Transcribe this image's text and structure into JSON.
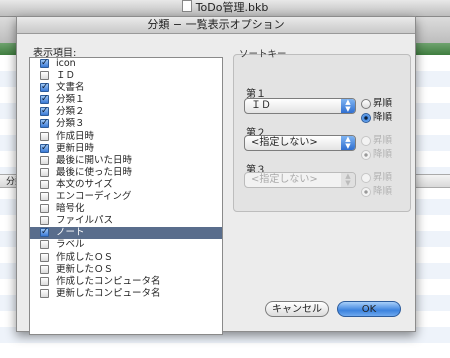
{
  "window": {
    "title": "ToDo管理.bkb"
  },
  "background": {
    "column_header": "分類名"
  },
  "dialog": {
    "title": "分類 − 一覧表示オプション",
    "list_label": "表示項目:",
    "items": [
      {
        "label": "icon",
        "checked": true
      },
      {
        "label": "ＩＤ",
        "checked": false
      },
      {
        "label": "文書名",
        "checked": true
      },
      {
        "label": "分類１",
        "checked": true
      },
      {
        "label": "分類２",
        "checked": true
      },
      {
        "label": "分類３",
        "checked": true
      },
      {
        "label": "作成日時",
        "checked": false
      },
      {
        "label": "更新日時",
        "checked": true
      },
      {
        "label": "最後に開いた日時",
        "checked": false
      },
      {
        "label": "最後に使った日時",
        "checked": false
      },
      {
        "label": "本文のサイズ",
        "checked": false
      },
      {
        "label": "エンコーディング",
        "checked": false
      },
      {
        "label": "暗号化",
        "checked": false
      },
      {
        "label": "ファイルパス",
        "checked": false
      },
      {
        "label": "ノート",
        "checked": true,
        "selected": true
      },
      {
        "label": "ラベル",
        "checked": false
      },
      {
        "label": "作成したＯＳ",
        "checked": false
      },
      {
        "label": "更新したＯＳ",
        "checked": false
      },
      {
        "label": "作成したコンピュータ名",
        "checked": false
      },
      {
        "label": "更新したコンピュータ名",
        "checked": false
      }
    ],
    "sort": {
      "group_label": "ソートキー",
      "keys": [
        {
          "label": "第１",
          "value": "ＩＤ",
          "enabled": true,
          "ascending": "昇順",
          "descending": "降順",
          "order": "descending"
        },
        {
          "label": "第２",
          "value": "<指定しない>",
          "enabled": true,
          "ascending": "昇順",
          "descending": "降順",
          "order": "descending"
        },
        {
          "label": "第３",
          "value": "<指定しない>",
          "enabled": false,
          "ascending": "昇順",
          "descending": "降順",
          "order": "descending"
        }
      ]
    },
    "buttons": {
      "cancel": "キャンセル",
      "ok": "OK"
    }
  }
}
